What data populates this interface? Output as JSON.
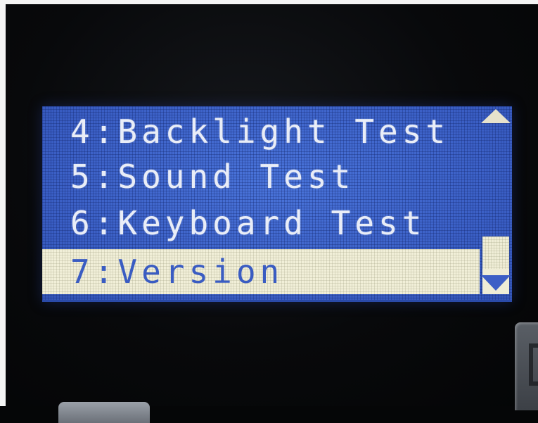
{
  "screen": {
    "menu_items": [
      {
        "label": "4:Backlight Test",
        "selected": false
      },
      {
        "label": "5:Sound Test",
        "selected": false
      },
      {
        "label": "6:Keyboard Test",
        "selected": false
      },
      {
        "label": "7:Version",
        "selected": true
      }
    ],
    "scrollbar": {
      "up_icon": "triangle-up-icon",
      "down_icon": "triangle-down-icon",
      "position_fraction": 1.0
    },
    "colors": {
      "lcd_background": "#3e63c9",
      "text_normal": "#e9edf7",
      "highlight_background": "#f1efd8",
      "highlight_text": "#3a5cc2"
    }
  }
}
